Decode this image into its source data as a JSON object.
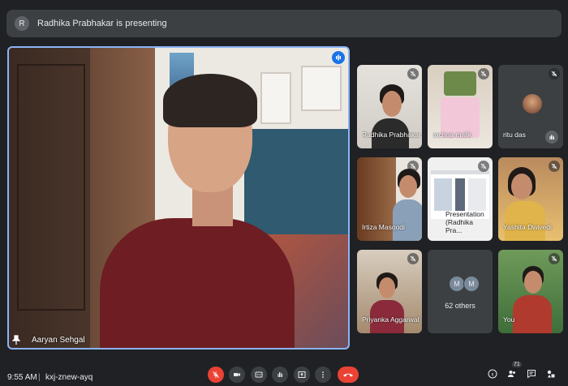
{
  "banner": {
    "avatar_letter": "R",
    "text": "Radhika Prabhakar is presenting"
  },
  "main": {
    "participant_name": "Aaryan Sehgal"
  },
  "grid": {
    "tiles": [
      {
        "name": "Radhika Prabhakar"
      },
      {
        "name": "rachna malik"
      },
      {
        "name": "ritu das"
      },
      {
        "name": "Irtiza Masoodi"
      },
      {
        "name": "Presentation (Radhika Pra..."
      },
      {
        "name": "Yashita Dwivedi"
      },
      {
        "name": "Priyanka Aggarwal"
      },
      {
        "others_avatar1": "M",
        "others_avatar2": "M",
        "name": "62 others"
      },
      {
        "name": "You"
      }
    ]
  },
  "bottom_bar": {
    "time": "9:55 AM",
    "separator": "|",
    "meeting_code": "kxj-znew-ayq",
    "people_count": "71"
  },
  "colors": {
    "background": "#202124",
    "tile": "#3c4043",
    "accent": "#8ab4f8",
    "speaking": "#1a73e8",
    "end_call": "#ea4335"
  }
}
